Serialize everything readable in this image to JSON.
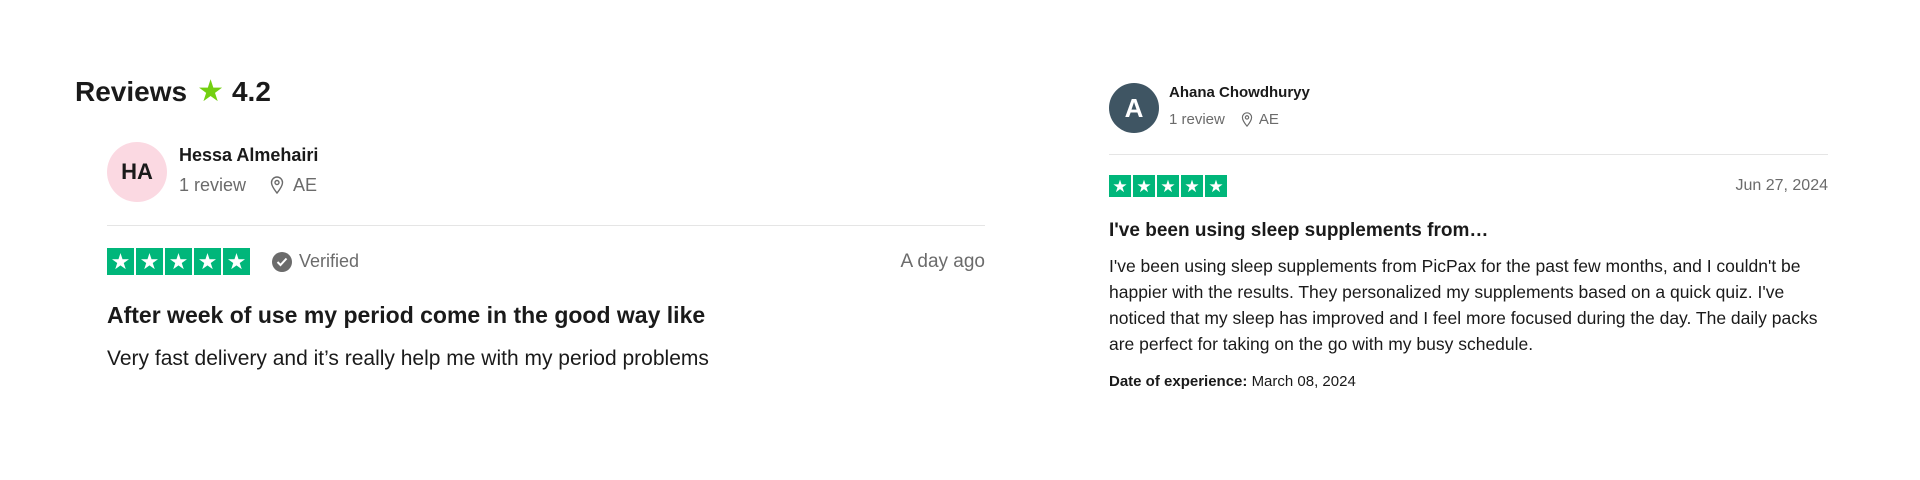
{
  "header": {
    "title": "Reviews",
    "rating": "4.2",
    "star_color": "#73cf11"
  },
  "reviews": [
    {
      "avatar_initials": "HA",
      "avatar_color": "#fbd9e2",
      "name": "Hessa Almehairi",
      "review_count": "1 review",
      "country": "AE",
      "stars": 5,
      "verified_label": "Verified",
      "date": "A day ago",
      "title": "After week of use my period come in the good way like",
      "body": "Very fast delivery and it’s really help me with my period problems"
    },
    {
      "avatar_initials": "A",
      "avatar_color": "#3f5563",
      "name": "Ahana Chowdhuryy",
      "review_count": "1 review",
      "country": "AE",
      "stars": 5,
      "date": "Jun 27, 2024",
      "title": "I've been using sleep supplements from…",
      "body": "I've been using sleep supplements from PicPax for the past few months, and I couldn't be happier with the results. They personalized my supplements based on a quick quiz. I've noticed that my sleep has improved and I feel more focused during the day. The daily packs are perfect for taking on the go with my busy schedule.",
      "experience_label": "Date of experience:",
      "experience_date": "March 08, 2024"
    }
  ],
  "colors": {
    "star_box": "#00b67a",
    "muted_text": "#6b6b6b",
    "divider": "#e5e5e5"
  }
}
